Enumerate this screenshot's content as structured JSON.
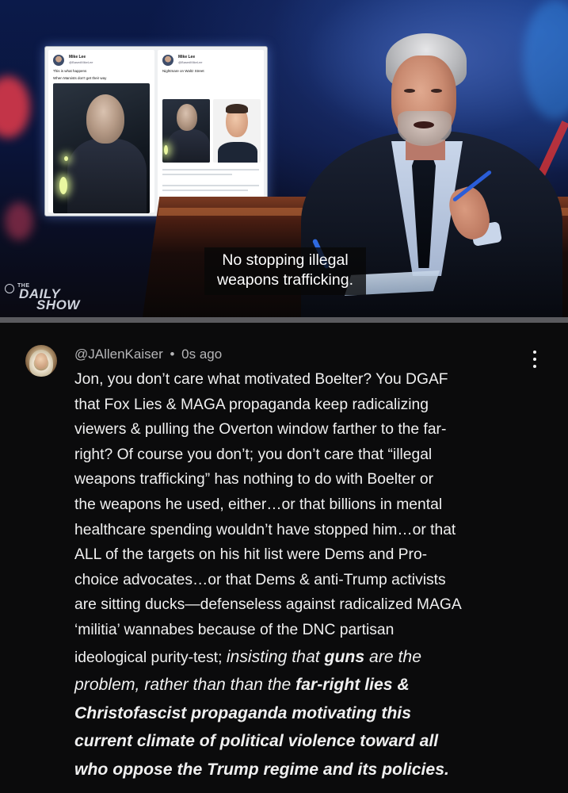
{
  "video": {
    "caption_line1": "No stopping illegal",
    "caption_line2": "weapons trafficking.",
    "logo_the": "THE",
    "logo_daily": "DAILY",
    "logo_show": "SHOW",
    "tweet1": {
      "name": "Mike Lee",
      "handle": "@BasedMikeLee",
      "line1": "This is what happens",
      "line2": "When Marxists don't get their way"
    },
    "tweet2": {
      "name": "Mike Lee",
      "handle": "@BasedMikeLee",
      "line1": "Nightmare on Waltz Street"
    }
  },
  "comment": {
    "author": "@JAllenKaiser",
    "separator": "•",
    "time": "0s ago",
    "lines": [
      "Jon, you don’t care what motivated Boelter? You DGAF",
      "that Fox Lies & MAGA propaganda keep radicalizing",
      "viewers & pulling the Overton window farther to the far-",
      "right? Of course you don’t; you don’t care that “illegal",
      "weapons trafficking” has nothing to do with Boelter or",
      "the weapons he used, either…or that billions in mental",
      "healthcare spending wouldn’t have stopped him…or that",
      "ALL of the targets on his hit list were Dems and Pro-",
      "choice advocates…or that Dems & anti-Trump activists",
      "are sitting ducks—defenseless against radicalized MAGA",
      "‘militia’ wannabes because of the DNC partisan"
    ],
    "line12_plain": "ideological purity-test;",
    "line12_em_a": "insisting that",
    "line12_em_bold": "guns",
    "line12_em_b": "are the",
    "line13_em": "problem, rather than than the",
    "line13_bold": "far-right lies &",
    "line14": "Christofascist propaganda motivating this",
    "line15": "current climate of political violence toward all",
    "line16": "who oppose the Trump regime and its policies."
  }
}
